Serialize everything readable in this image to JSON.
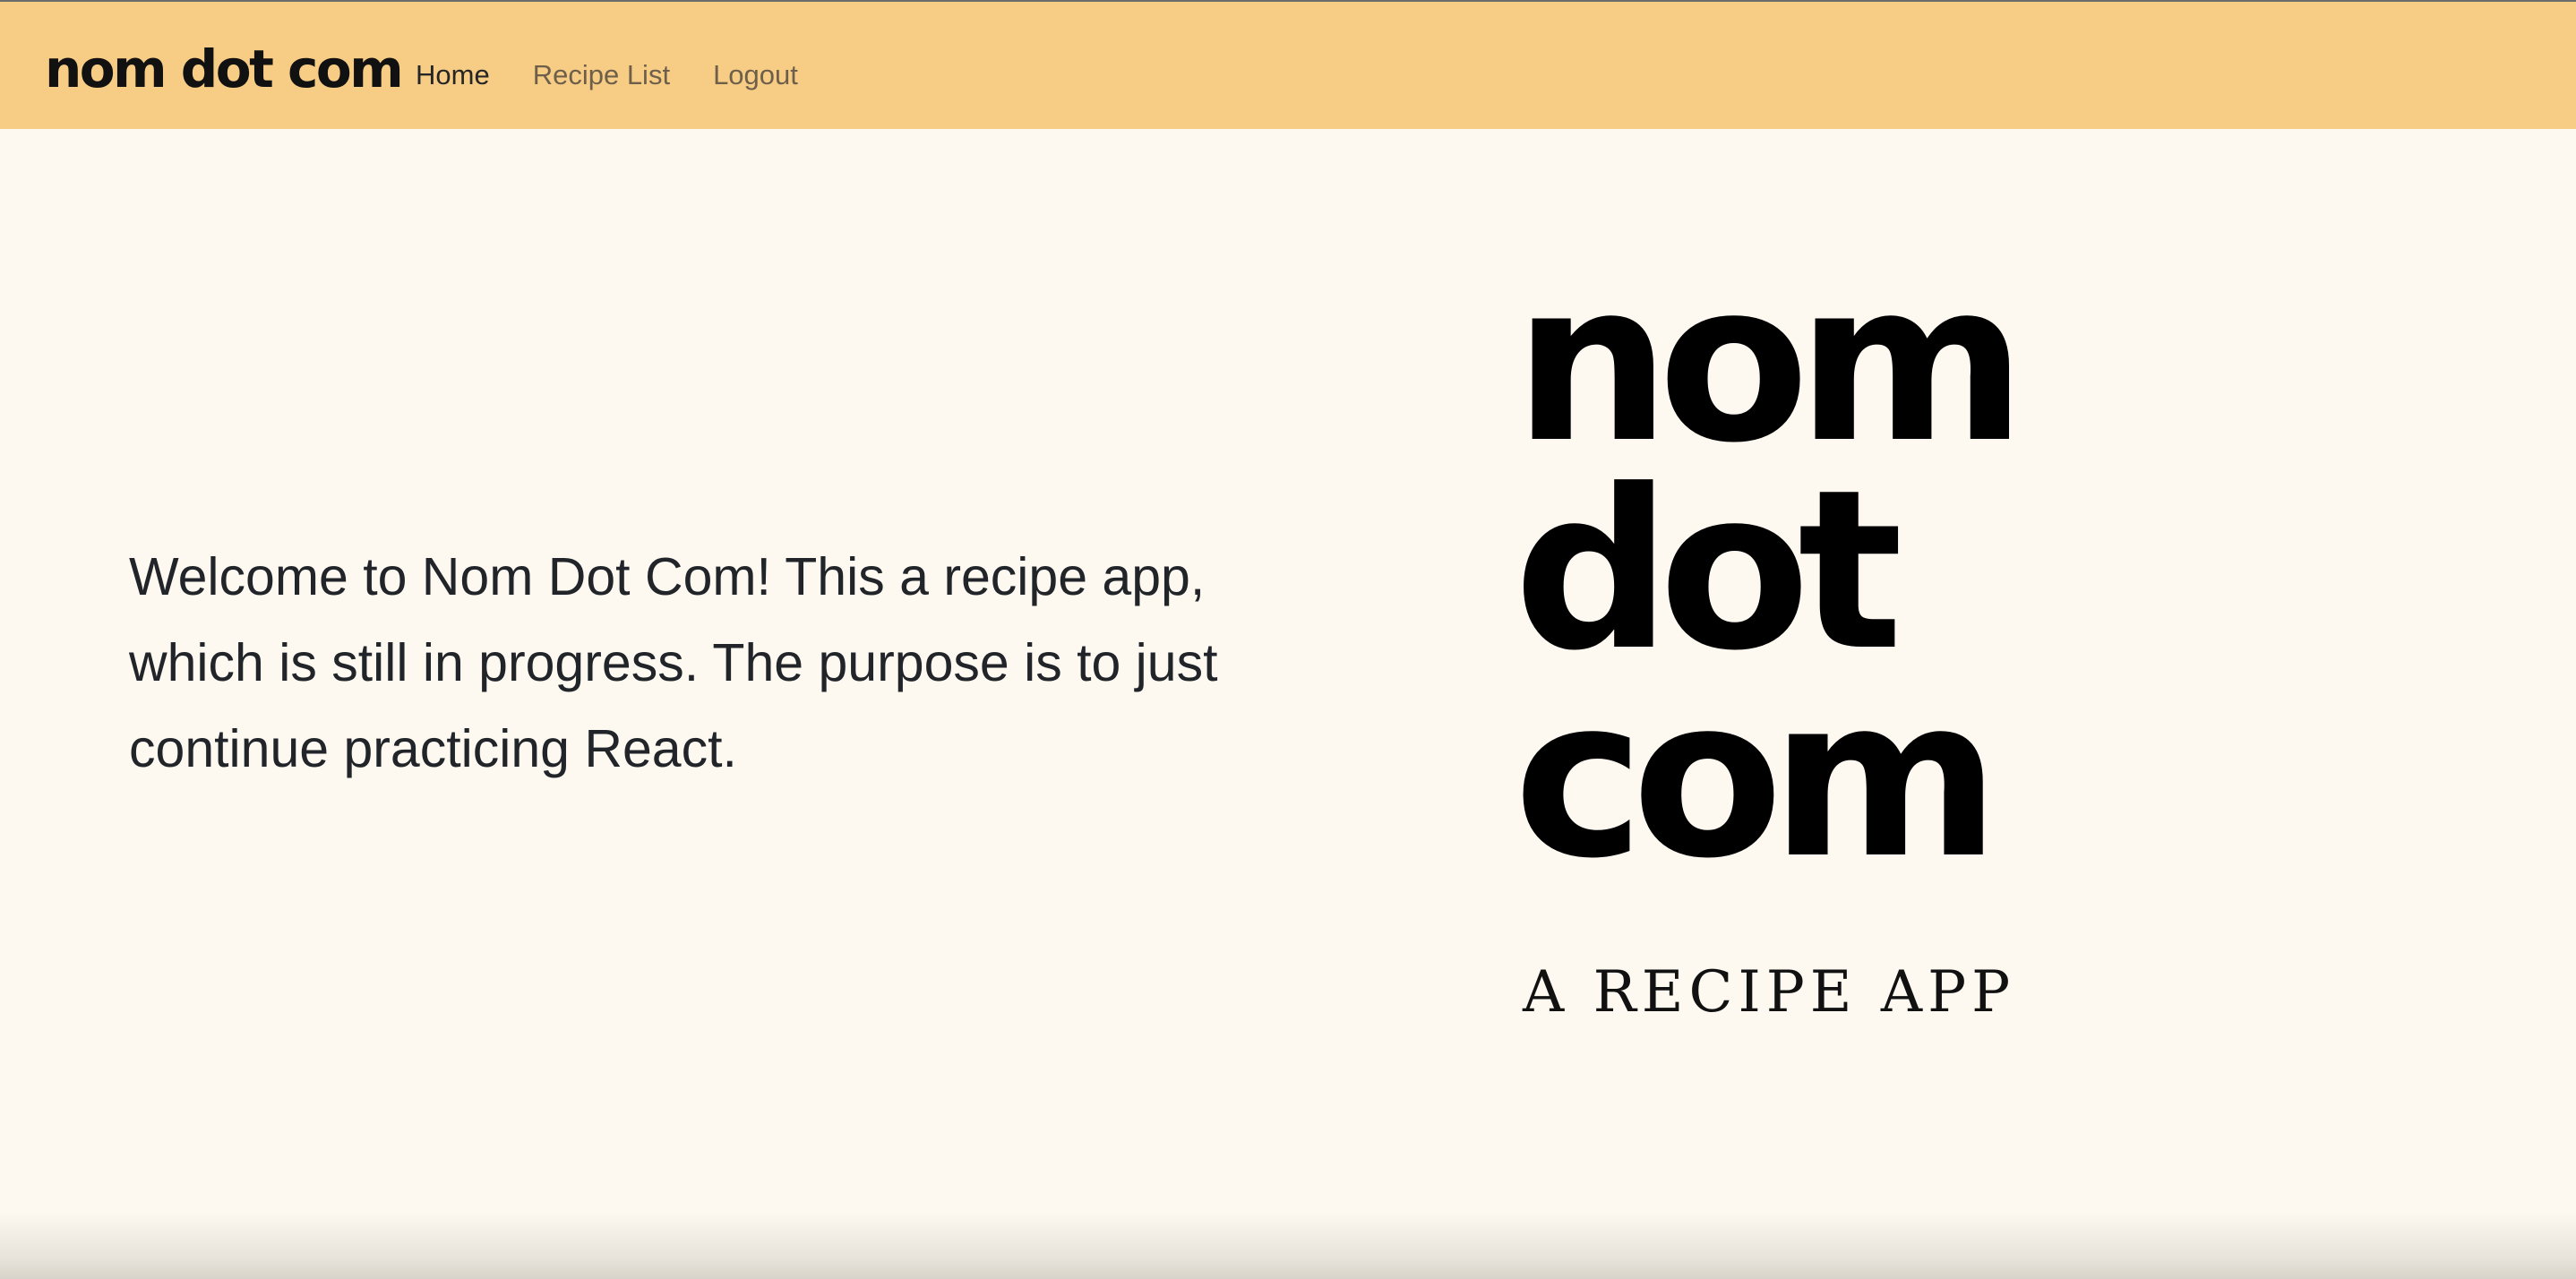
{
  "navbar": {
    "brand": "nom dot com",
    "links": [
      {
        "label": "Home",
        "active": true
      },
      {
        "label": "Recipe List",
        "active": false
      },
      {
        "label": "Logout",
        "active": false
      }
    ]
  },
  "main": {
    "welcome_text": "Welcome to Nom Dot Com! This a recipe app, which is still in progress. The purpose is to just continue practicing React.",
    "logo": {
      "lines": [
        "nom",
        "dot",
        "com"
      ],
      "tagline": "A RECIPE APP"
    }
  },
  "colors": {
    "navbar_bg": "#f7cd85",
    "page_bg": "#fdf8f0",
    "text": "#212529"
  }
}
